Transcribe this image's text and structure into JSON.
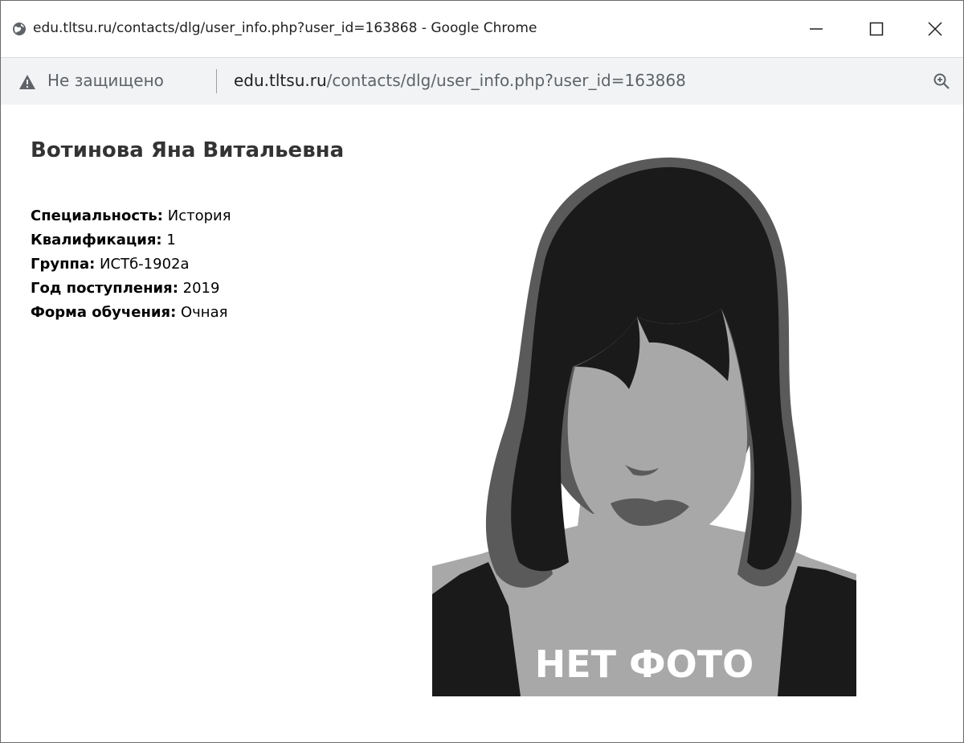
{
  "window": {
    "title": "edu.tltsu.ru/contacts/dlg/user_info.php?user_id=163868 - Google Chrome",
    "controls": {
      "minimize": "minimize-icon",
      "maximize": "maximize-icon",
      "close": "close-icon"
    }
  },
  "addressbar": {
    "security_label": "Не защищено",
    "url_domain": "edu.tltsu.ru",
    "url_path": "/contacts/dlg/user_info.php?user_id=163868",
    "warning_icon": "warning-triangle-icon",
    "zoom_icon": "zoom-in-icon"
  },
  "profile": {
    "name": "Вотинова Яна Витальевна",
    "fields": [
      {
        "label": "Специальность:",
        "value": "История"
      },
      {
        "label": "Квалификация:",
        "value": "1"
      },
      {
        "label": "Группа:",
        "value": "ИСТб-1902а"
      },
      {
        "label": "Год поступления:",
        "value": "2019"
      },
      {
        "label": "Форма обучения:",
        "value": "Очная"
      }
    ],
    "photo_caption": "НЕТ ФОТО"
  },
  "colors": {
    "window_border": "#6b6b6b",
    "toolbar_bg": "#f1f3f4",
    "text_muted": "#5f6368",
    "hair": "#1a1a1a",
    "hair_mid": "#5a5a5a",
    "skin": "#a8a8a8",
    "caption": "#ffffff"
  }
}
